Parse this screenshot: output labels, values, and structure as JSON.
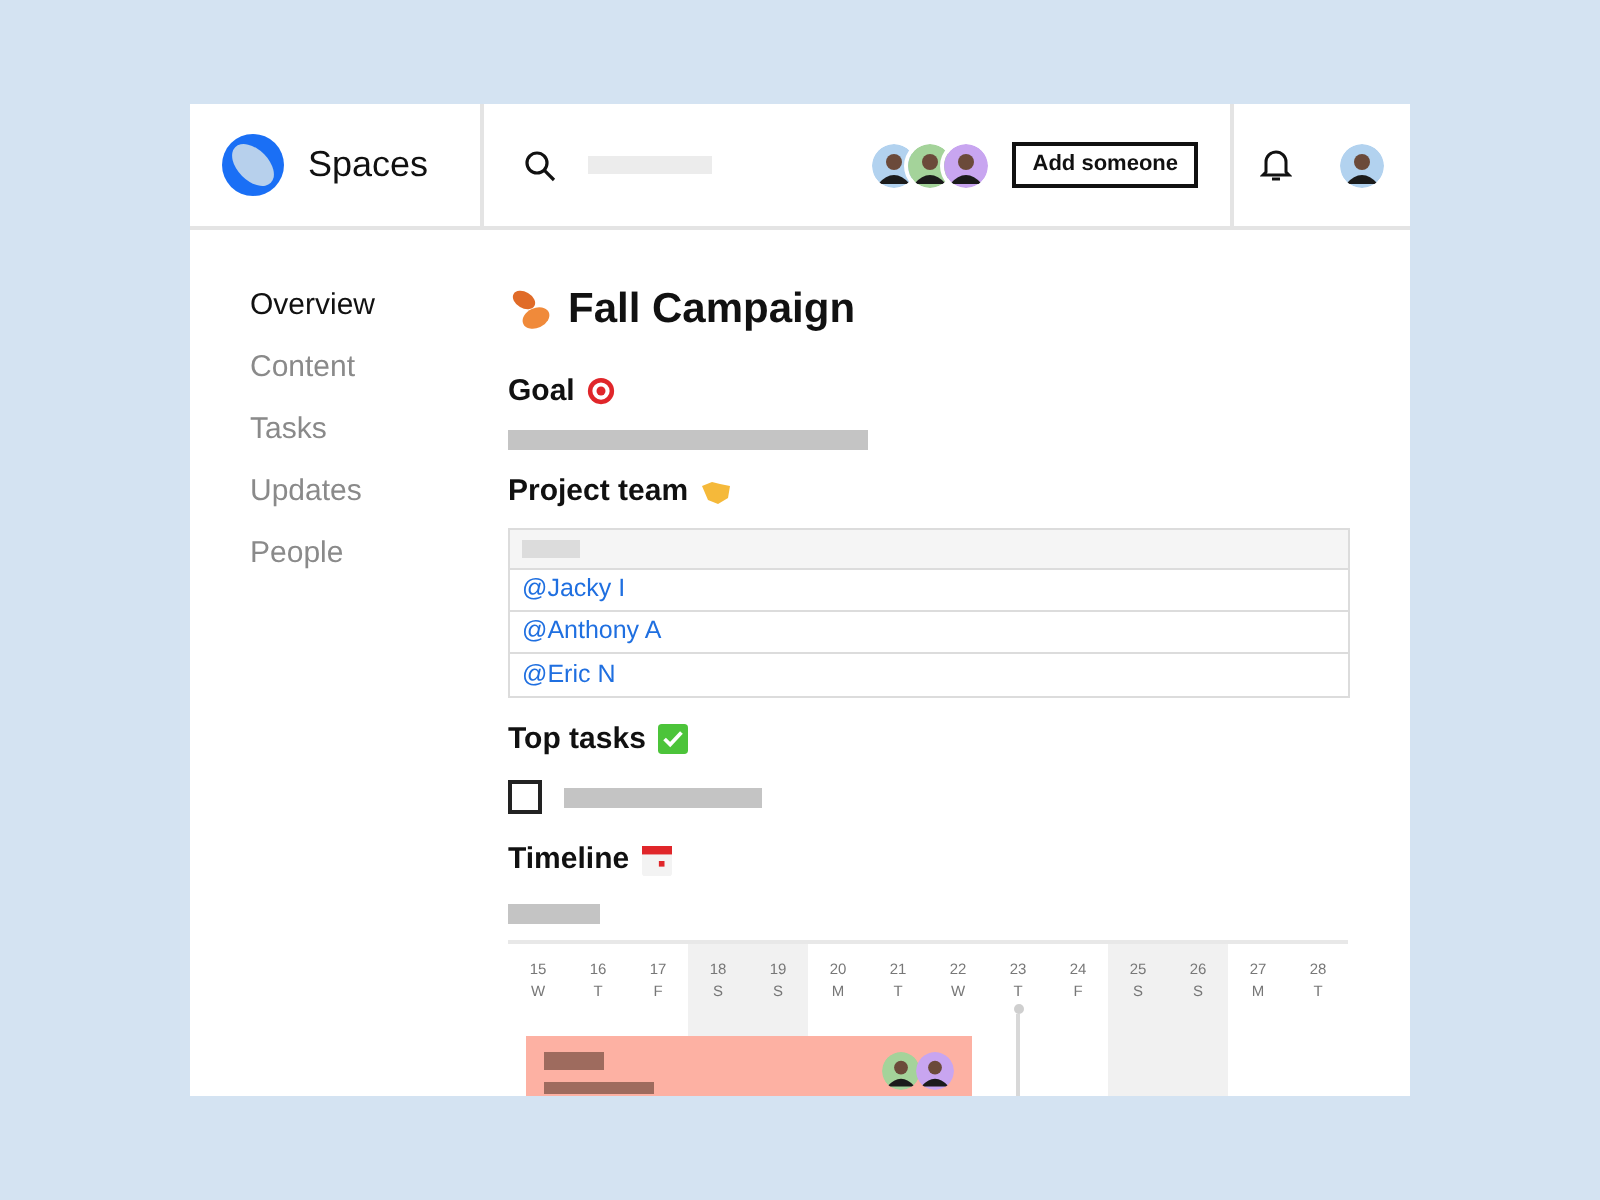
{
  "app": {
    "name": "Spaces"
  },
  "header": {
    "add_button": "Add someone"
  },
  "nav": [
    {
      "label": "Overview",
      "selected": true
    },
    {
      "label": "Content",
      "selected": false
    },
    {
      "label": "Tasks",
      "selected": false
    },
    {
      "label": "Updates",
      "selected": false
    },
    {
      "label": "People",
      "selected": false
    }
  ],
  "page": {
    "title": "Fall Campaign"
  },
  "sections": {
    "goal": "Goal",
    "team": "Project team",
    "tasks": "Top tasks",
    "timeline": "Timeline"
  },
  "team": [
    "@Jacky I",
    "@Anthony A",
    "@Eric N"
  ],
  "tasks": [
    {
      "checked": false
    }
  ],
  "timeline": {
    "days": [
      {
        "date": "15",
        "weekday": "W",
        "weekend": false,
        "today": false
      },
      {
        "date": "16",
        "weekday": "T",
        "weekend": false,
        "today": false
      },
      {
        "date": "17",
        "weekday": "F",
        "weekend": false,
        "today": false
      },
      {
        "date": "18",
        "weekday": "S",
        "weekend": true,
        "today": false
      },
      {
        "date": "19",
        "weekday": "S",
        "weekend": true,
        "today": false
      },
      {
        "date": "20",
        "weekday": "M",
        "weekend": false,
        "today": false
      },
      {
        "date": "21",
        "weekday": "T",
        "weekend": false,
        "today": false
      },
      {
        "date": "22",
        "weekday": "W",
        "weekend": false,
        "today": false
      },
      {
        "date": "23",
        "weekday": "T",
        "weekend": false,
        "today": true
      },
      {
        "date": "24",
        "weekday": "F",
        "weekend": false,
        "today": false
      },
      {
        "date": "25",
        "weekday": "S",
        "weekend": true,
        "today": false
      },
      {
        "date": "26",
        "weekday": "S",
        "weekend": true,
        "today": false
      },
      {
        "date": "27",
        "weekday": "M",
        "weekend": false,
        "today": false
      },
      {
        "date": "28",
        "weekday": "T",
        "weekend": false,
        "today": false
      }
    ]
  }
}
